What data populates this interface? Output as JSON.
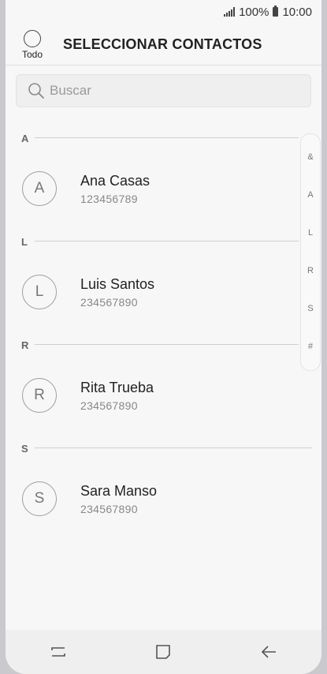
{
  "status_bar": {
    "battery": "100%",
    "time": "10:00"
  },
  "header": {
    "select_all_label": "Todo",
    "title": "SELECCIONAR CONTACTOS"
  },
  "search": {
    "placeholder": "Buscar"
  },
  "sections": [
    {
      "letter": "A",
      "contact": {
        "initial": "A",
        "name": "Ana Casas",
        "phone": "123456789"
      }
    },
    {
      "letter": "L",
      "contact": {
        "initial": "L",
        "name": "Luis Santos",
        "phone": "234567890"
      }
    },
    {
      "letter": "R",
      "contact": {
        "initial": "R",
        "name": "Rita Trueba",
        "phone": "234567890"
      }
    },
    {
      "letter": "S",
      "contact": {
        "initial": "S",
        "name": "Sara Manso",
        "phone": "234567890"
      }
    }
  ],
  "index_bar": [
    "&",
    "A",
    "L",
    "R",
    "S",
    "#"
  ],
  "nav_bar": {
    "icons": [
      "recent-apps-icon",
      "home-icon",
      "back-icon"
    ]
  },
  "colors": {
    "background": "#f7f7f7",
    "text": "#222222",
    "secondary_text": "#888888",
    "divider": "#cfcfcf"
  }
}
